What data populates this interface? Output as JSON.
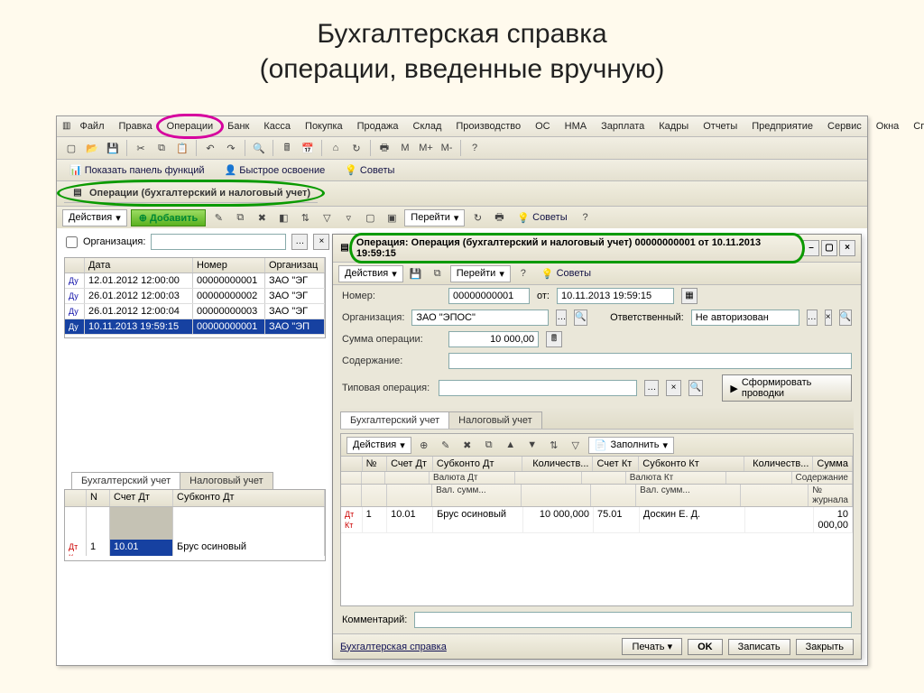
{
  "slide": {
    "title_line1": "Бухгалтерская справка",
    "title_line2": "(операции, введенные вручную)"
  },
  "menu": [
    "Файл",
    "Правка",
    "Операции",
    "Банк",
    "Касса",
    "Покупка",
    "Продажа",
    "Склад",
    "Производство",
    "ОС",
    "НМА",
    "Зарплата",
    "Кадры",
    "Отчеты",
    "Предприятие",
    "Сервис",
    "Окна",
    "Справка"
  ],
  "info_toolbar": {
    "show_panel": "Показать панель функций",
    "quick_start": "Быстрое освоение",
    "tips": "Советы"
  },
  "list_window": {
    "title": "Операции (бухгалтерский и налоговый учет)",
    "actions": "Действия",
    "add": "Добавить",
    "go": "Перейти",
    "tips": "Советы",
    "filter_label": "Организация:",
    "columns": [
      "",
      "Дата",
      "Номер",
      "Организац"
    ],
    "rows": [
      {
        "date": "12.01.2012 12:00:00",
        "num": "00000000001",
        "org": "ЗАО \"ЭГ"
      },
      {
        "date": "26.01.2012 12:00:03",
        "num": "00000000002",
        "org": "ЗАО \"ЭГ"
      },
      {
        "date": "26.01.2012 12:00:04",
        "num": "00000000003",
        "org": "ЗАО \"ЭГ"
      },
      {
        "date": "10.11.2013 19:59:15",
        "num": "00000000001",
        "org": "ЗАО \"ЭП"
      }
    ],
    "tabs": [
      "Бухгалтерский учет",
      "Налоговый учет"
    ],
    "grid2": {
      "columns": [
        "",
        "N",
        "Счет Дт",
        "Субконто Дт"
      ],
      "row": {
        "n": "1",
        "dt": "10.01",
        "sub": "Брус осиновый"
      }
    }
  },
  "op_window": {
    "title": "Операция: Операция (бухгалтерский и налоговый учет) 00000000001 от 10.11.2013 19:59:15",
    "actions": "Действия",
    "go": "Перейти",
    "tips": "Советы",
    "form": {
      "number_label": "Номер:",
      "number": "00000000001",
      "from_label": "от:",
      "from": "10.11.2013 19:59:15",
      "org_label": "Организация:",
      "org": "ЗАО \"ЭПОС\"",
      "resp_label": "Ответственный:",
      "resp": "Не авторизован",
      "sum_label": "Сумма операции:",
      "sum": "10 000,00",
      "content_label": "Содержание:",
      "typical_label": "Типовая операция:",
      "generate": "Сформировать проводки"
    },
    "tabs": [
      "Бухгалтерский учет",
      "Налоговый учет"
    ],
    "grid_actions": "Действия",
    "fill": "Заполнить",
    "grid": {
      "head1": [
        "",
        "№",
        "Счет Дт",
        "Субконто Дт",
        "Количеств...",
        "Счет Кт",
        "Субконто Кт",
        "Количеств...",
        "Сумма"
      ],
      "head2_left": [
        "Валюта Дт",
        "Вал. сумм..."
      ],
      "head2_right": [
        "Валюта Кт",
        "Вал. сумм..."
      ],
      "head2_far": [
        "Содержание",
        "№ журнала"
      ],
      "row": {
        "n": "1",
        "dt": "10.01",
        "subdt": "Брус осиновый",
        "qty": "10 000,000",
        "kt": "75.01",
        "subkt": "Доскин Е. Д.",
        "sum": "10 000,00"
      }
    },
    "comment_label": "Комментарий:",
    "footer": {
      "print_link": "Бухгалтерская справка",
      "print": "Печать",
      "ok": "OK",
      "save": "Записать",
      "close": "Закрыть"
    }
  }
}
